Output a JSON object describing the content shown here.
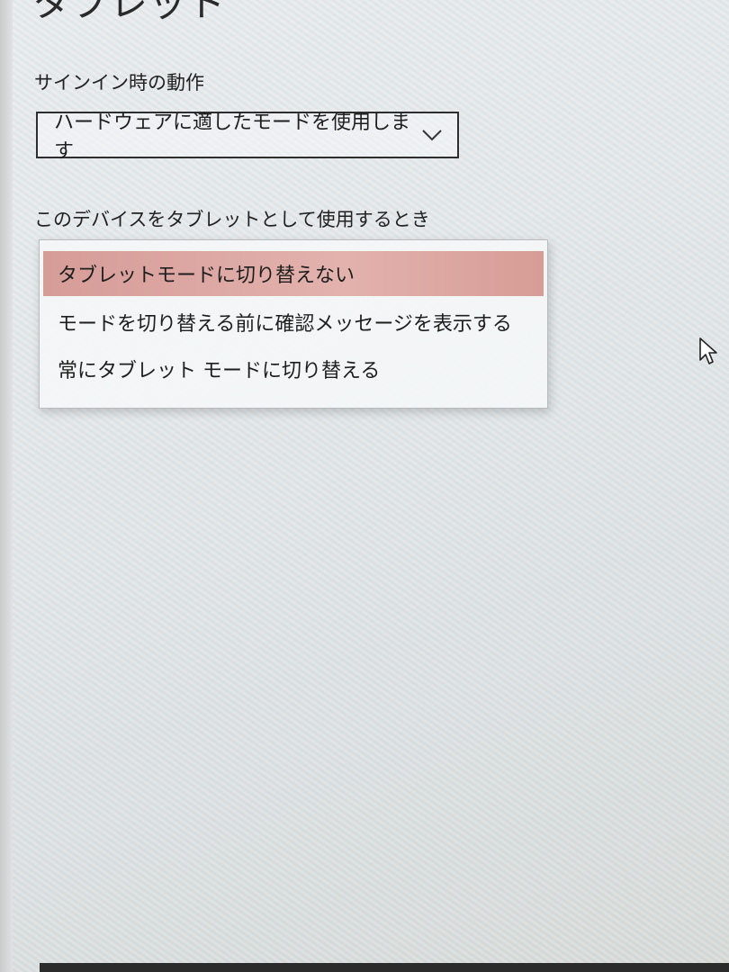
{
  "page": {
    "title": "タブレット"
  },
  "signin": {
    "label": "サインイン時の動作",
    "selected_value": "ハードウェアに適したモードを使用します",
    "chevron_icon": "chevron-down-icon"
  },
  "tablet_use": {
    "label": "このデバイスをタブレットとして使用するとき",
    "options": [
      {
        "label": "タブレットモードに切り替えない",
        "selected": true
      },
      {
        "label": "モードを切り替える前に確認メッセージを表示する",
        "selected": false
      },
      {
        "label": "常にタブレット モードに切り替える",
        "selected": false
      }
    ]
  },
  "colors": {
    "selected_highlight": "#d9a19c",
    "border": "#2e2e2e"
  },
  "cursor_icon": "mouse-pointer-icon"
}
